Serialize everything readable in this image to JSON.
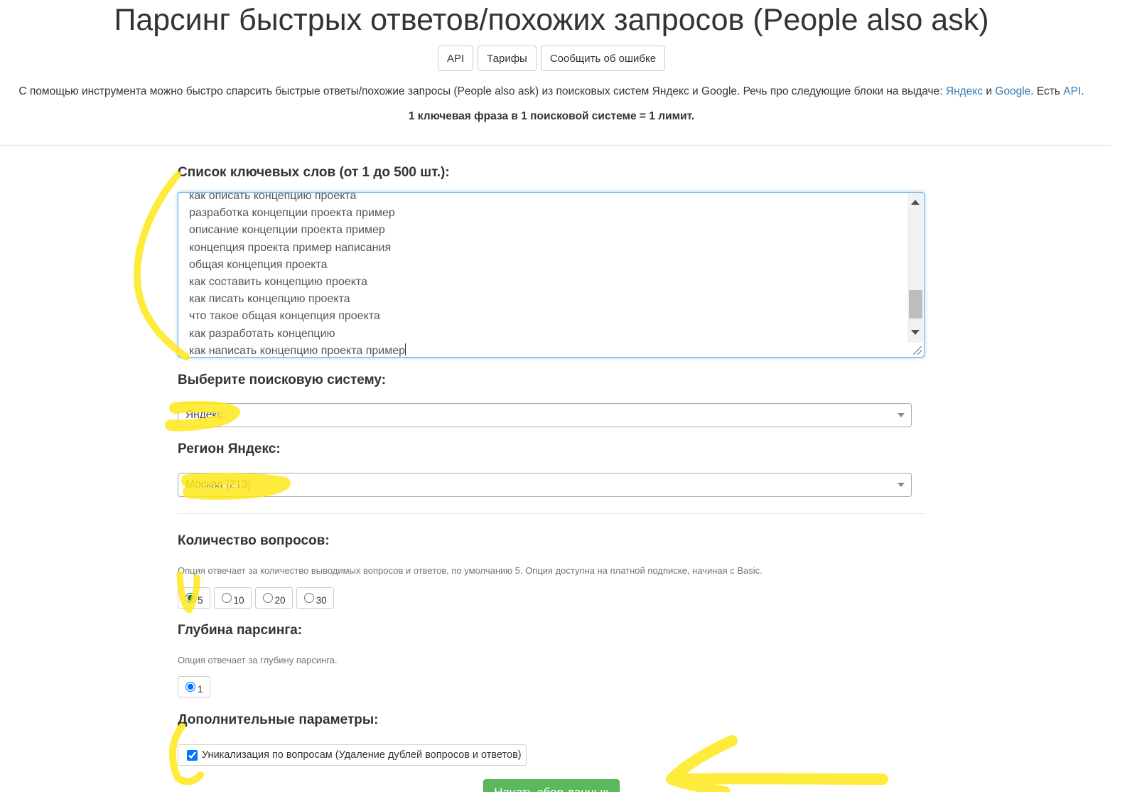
{
  "header": {
    "title": "Парсинг быстрых ответов/похожих запросов (People also ask)",
    "buttons": [
      "API",
      "Тарифы",
      "Сообщить об ошибке"
    ]
  },
  "intro": {
    "text": "С помощью инструмента можно быстро спарсить быстрые ответы/похожие запросы (People also ask) из поисковых систем Яндекс и Google. Речь про следующие блоки на выдаче:",
    "link_yandex": "Яндекс",
    "and_word": "и",
    "link_google": "Google",
    "api_prefix": ". Есть",
    "link_api": "API",
    "end": "."
  },
  "limit_note": "1 ключевая фраза в 1 поисковой системе = 1 лимит.",
  "keywords": {
    "label": "Список ключевых слов (от 1 до 500 шт.):",
    "lines": [
      "как описать концепцию проекта",
      "разработка концепции проекта пример",
      "описание концепции проекта пример",
      "концепция проекта пример написания",
      "общая концепция проекта",
      "как составить концепцию проекта",
      "как писать концепцию проекта",
      "что такое общая концепция проекта",
      "как разработать концепцию",
      "как написать концепцию проекта пример"
    ]
  },
  "search_engine": {
    "label": "Выберите поисковую систему:",
    "selected": "Яндекс"
  },
  "region": {
    "label": "Регион Яндекс:",
    "selected": "Москва [213]"
  },
  "questions_count": {
    "label": "Количество вопросов:",
    "help": "Опция отвечает за количество выводимых вопросов и ответов, по умолчанию 5. Опция доступна на платной подписке, начиная с Basic.",
    "options": [
      "5",
      "10",
      "20",
      "30"
    ],
    "selected": "5"
  },
  "depth": {
    "label": "Глубина парсинга:",
    "help": "Опция отвечает за глубину парсинга.",
    "options": [
      "1"
    ],
    "selected": "1"
  },
  "extra": {
    "label": "Дополнительные параметры:",
    "uniq_label": "Уникализация по вопросам (Удаление дублей вопросов и ответов)",
    "uniq_checked": true
  },
  "submit_label": "Начать сбор данных",
  "colors": {
    "link": "#337ab7",
    "submit": "#5cb85c",
    "highlight": "#ffe81a",
    "focus_border": "#66afe9"
  }
}
